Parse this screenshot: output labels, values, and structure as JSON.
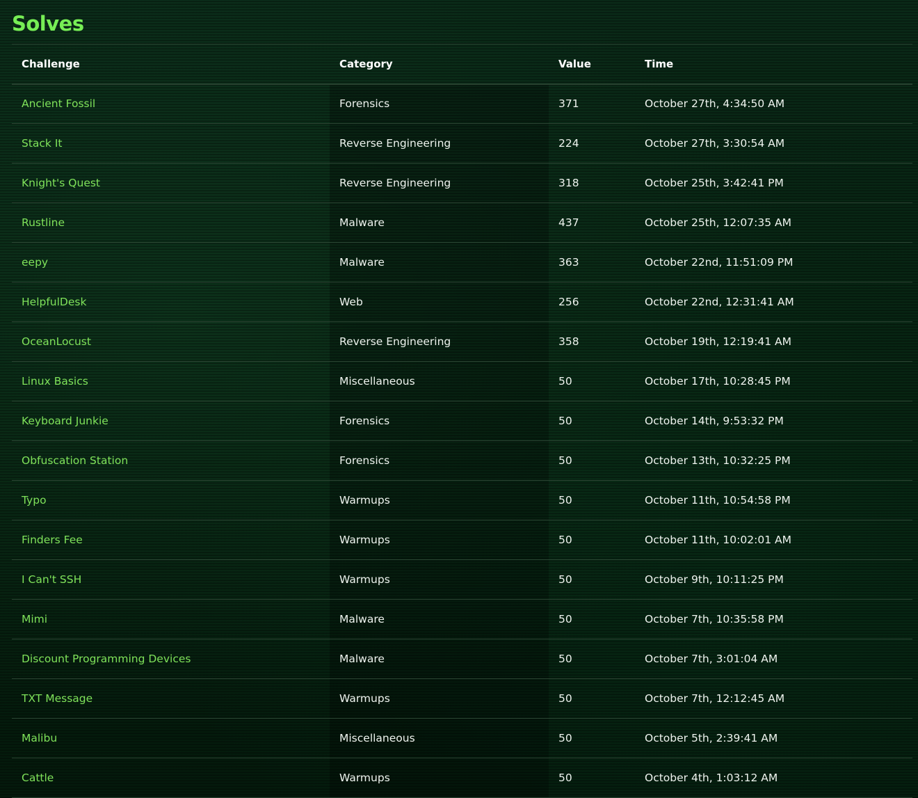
{
  "page": {
    "title": "Solves"
  },
  "table": {
    "headers": {
      "challenge": "Challenge",
      "category": "Category",
      "value": "Value",
      "time": "Time"
    },
    "rows": [
      {
        "challenge": "Ancient Fossil",
        "category": "Forensics",
        "value": "371",
        "time": "October 27th, 4:34:50 AM"
      },
      {
        "challenge": "Stack It",
        "category": "Reverse Engineering",
        "value": "224",
        "time": "October 27th, 3:30:54 AM"
      },
      {
        "challenge": "Knight's Quest",
        "category": "Reverse Engineering",
        "value": "318",
        "time": "October 25th, 3:42:41 PM"
      },
      {
        "challenge": "Rustline",
        "category": "Malware",
        "value": "437",
        "time": "October 25th, 12:07:35 AM"
      },
      {
        "challenge": "eepy",
        "category": "Malware",
        "value": "363",
        "time": "October 22nd, 11:51:09 PM"
      },
      {
        "challenge": "HelpfulDesk",
        "category": "Web",
        "value": "256",
        "time": "October 22nd, 12:31:41 AM"
      },
      {
        "challenge": "OceanLocust",
        "category": "Reverse Engineering",
        "value": "358",
        "time": "October 19th, 12:19:41 AM"
      },
      {
        "challenge": "Linux Basics",
        "category": "Miscellaneous",
        "value": "50",
        "time": "October 17th, 10:28:45 PM"
      },
      {
        "challenge": "Keyboard Junkie",
        "category": "Forensics",
        "value": "50",
        "time": "October 14th, 9:53:32 PM"
      },
      {
        "challenge": "Obfuscation Station",
        "category": "Forensics",
        "value": "50",
        "time": "October 13th, 10:32:25 PM"
      },
      {
        "challenge": "Typo",
        "category": "Warmups",
        "value": "50",
        "time": "October 11th, 10:54:58 PM"
      },
      {
        "challenge": "Finders Fee",
        "category": "Warmups",
        "value": "50",
        "time": "October 11th, 10:02:01 AM"
      },
      {
        "challenge": "I Can't SSH",
        "category": "Warmups",
        "value": "50",
        "time": "October 9th, 10:11:25 PM"
      },
      {
        "challenge": "Mimi",
        "category": "Malware",
        "value": "50",
        "time": "October 7th, 10:35:58 PM"
      },
      {
        "challenge": "Discount Programming Devices",
        "category": "Malware",
        "value": "50",
        "time": "October 7th, 3:01:04 AM"
      },
      {
        "challenge": "TXT Message",
        "category": "Warmups",
        "value": "50",
        "time": "October 7th, 12:12:45 AM"
      },
      {
        "challenge": "Malibu",
        "category": "Miscellaneous",
        "value": "50",
        "time": "October 5th, 2:39:41 AM"
      },
      {
        "challenge": "Cattle",
        "category": "Warmups",
        "value": "50",
        "time": "October 4th, 1:03:12 AM"
      }
    ]
  },
  "colors": {
    "title": "#77ee55",
    "link": "#7fe25a",
    "text": "#eef3ee",
    "divider": "#2a4432"
  }
}
